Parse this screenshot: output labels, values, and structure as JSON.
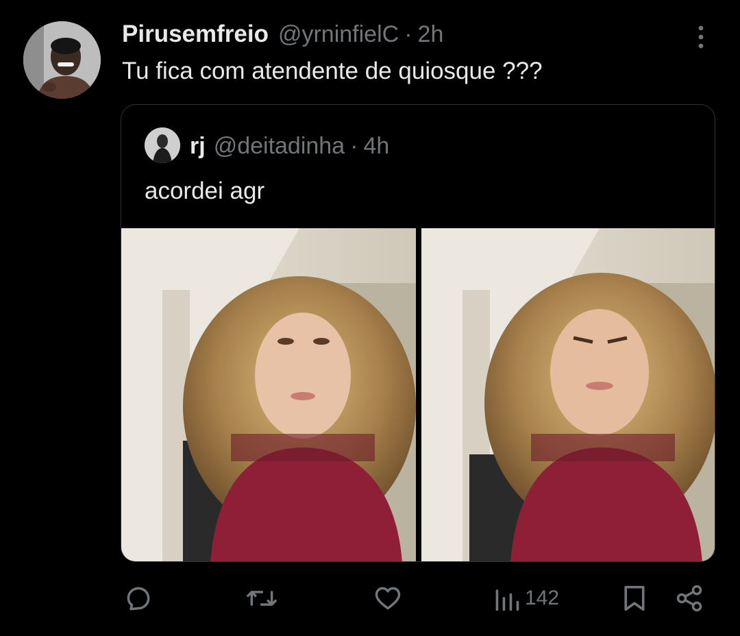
{
  "tweet": {
    "display_name": "Pirusemfreio",
    "handle": "@yrninfielC",
    "separator": "·",
    "time": "2h",
    "text": "Tu fica com atendente de quiosque ???"
  },
  "quoted_tweet": {
    "display_name": "rj",
    "handle": "@deitadinha",
    "separator": "·",
    "time": "4h",
    "text": "acordei agr",
    "media": [
      "photo-neutral-face",
      "photo-scrunched-face"
    ]
  },
  "actions": {
    "reply_icon": "reply-icon",
    "retweet_icon": "retweet-icon",
    "like_icon": "heart-icon",
    "views_icon": "views-chart-icon",
    "views_count": "142",
    "bookmark_icon": "bookmark-icon",
    "share_icon": "share-icon"
  },
  "colors": {
    "background": "#000000",
    "text_primary": "#e7e9ea",
    "text_secondary": "#71767b",
    "border": "#2f3336"
  }
}
